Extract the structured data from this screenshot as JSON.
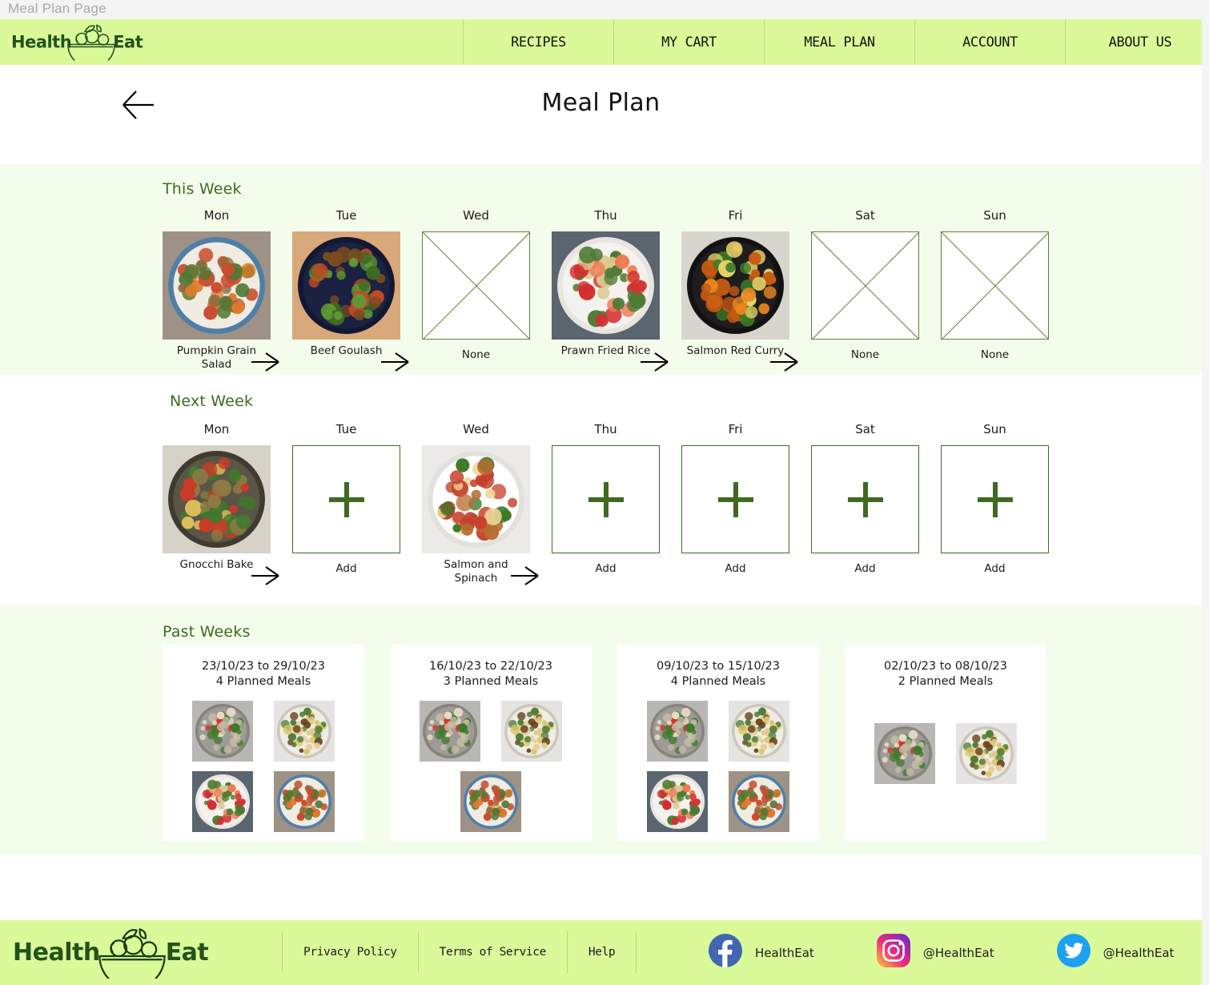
{
  "window": {
    "title": "Meal Plan Page"
  },
  "brand": {
    "name_left": "Health",
    "name_right": "Eat",
    "logo_icon": "salad-bowl-icon"
  },
  "nav": {
    "items": [
      {
        "label": "RECIPES"
      },
      {
        "label": "MY CART"
      },
      {
        "label": "MEAL PLAN"
      },
      {
        "label": "ACCOUNT"
      },
      {
        "label": "ABOUT US"
      }
    ]
  },
  "header": {
    "title": "Meal Plan",
    "back_icon": "back-arrow-icon"
  },
  "colors": {
    "nav_bg": "#dafa9a",
    "band_green": "#f4fdec",
    "heading_green": "#3d6b23",
    "outline_green": "#5d8236",
    "plus_green": "#3f6b21",
    "facebook": "#4267B2",
    "twitter": "#1DA1F2"
  },
  "this_week": {
    "heading": "This Week",
    "days": [
      {
        "day": "Mon",
        "meal": "Pumpkin Grain Salad",
        "state": "planned",
        "image": "pumpkin-grain-salad-photo",
        "arrow_icon": "chevron-right-arrow-icon"
      },
      {
        "day": "Tue",
        "meal": "Beef Goulash",
        "state": "planned",
        "image": "beef-goulash-photo",
        "arrow_icon": "chevron-right-arrow-icon"
      },
      {
        "day": "Wed",
        "meal": "None",
        "state": "empty",
        "image": "empty-crossed-box-icon"
      },
      {
        "day": "Thu",
        "meal": "Prawn Fried Rice",
        "state": "planned",
        "image": "prawn-fried-rice-photo",
        "arrow_icon": "chevron-right-arrow-icon"
      },
      {
        "day": "Fri",
        "meal": "Salmon Red Curry",
        "state": "planned",
        "image": "salmon-red-curry-photo",
        "arrow_icon": "chevron-right-arrow-icon"
      },
      {
        "day": "Sat",
        "meal": "None",
        "state": "empty",
        "image": "empty-crossed-box-icon"
      },
      {
        "day": "Sun",
        "meal": "None",
        "state": "empty",
        "image": "empty-crossed-box-icon"
      }
    ]
  },
  "next_week": {
    "heading": "Next Week",
    "days": [
      {
        "day": "Mon",
        "meal": "Gnocchi Bake",
        "state": "planned",
        "image": "gnocchi-bake-photo",
        "arrow_icon": "chevron-right-arrow-icon"
      },
      {
        "day": "Tue",
        "meal": "Add",
        "state": "add",
        "image": "plus-icon"
      },
      {
        "day": "Wed",
        "meal": "Salmon and Spinach",
        "state": "planned",
        "image": "salmon-and-spinach-photo",
        "arrow_icon": "chevron-right-arrow-icon"
      },
      {
        "day": "Thu",
        "meal": "Add",
        "state": "add",
        "image": "plus-icon"
      },
      {
        "day": "Fri",
        "meal": "Add",
        "state": "add",
        "image": "plus-icon"
      },
      {
        "day": "Sat",
        "meal": "Add",
        "state": "add",
        "image": "plus-icon"
      },
      {
        "day": "Sun",
        "meal": "Add",
        "state": "add",
        "image": "plus-icon"
      }
    ]
  },
  "past_weeks": {
    "heading": "Past Weeks",
    "cards": [
      {
        "range": "23/10/23 to 29/10/23",
        "count": "4 Planned Meals",
        "thumbs": [
          "chicken-greenbean-photo",
          "noodle-bowl-photo",
          "prawn-fried-rice-photo",
          "pumpkin-grain-salad-photo"
        ]
      },
      {
        "range": "16/10/23 to 22/10/23",
        "count": "3 Planned Meals",
        "thumbs": [
          "chicken-greenbean-photo",
          "noodle-bowl-photo",
          "pumpkin-grain-salad-photo"
        ]
      },
      {
        "range": "09/10/23 to 15/10/23",
        "count": "4 Planned Meals",
        "thumbs": [
          "chicken-greenbean-photo",
          "noodle-bowl-photo",
          "prawn-fried-rice-photo",
          "pumpkin-grain-salad-photo"
        ]
      },
      {
        "range": "02/10/23 to 08/10/23",
        "count": "2 Planned Meals",
        "thumbs": [
          "chicken-greenbean-photo",
          "noodle-bowl-photo"
        ]
      }
    ]
  },
  "footer": {
    "links": [
      {
        "label": "Privacy Policy"
      },
      {
        "label": "Terms of Service"
      },
      {
        "label": "Help"
      }
    ],
    "socials": [
      {
        "icon": "facebook-icon",
        "handle": "HealthEat"
      },
      {
        "icon": "instagram-icon",
        "handle": "@HealthEat"
      },
      {
        "icon": "twitter-icon",
        "handle": "@HealthEat"
      }
    ]
  }
}
